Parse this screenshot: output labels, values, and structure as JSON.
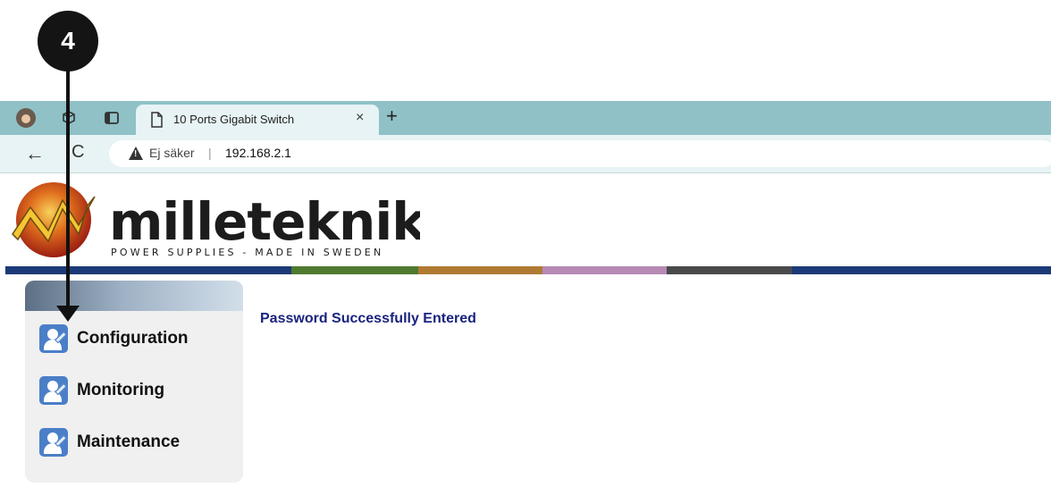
{
  "step": {
    "number": "4"
  },
  "browser": {
    "tab_title": "10 Ports Gigabit Switch",
    "tab_close": "×",
    "new_tab": "+",
    "security_label": "Ej säker",
    "url": "192.168.2.1",
    "back": "←",
    "reload": "C"
  },
  "header": {
    "logo_text": "milleteknik",
    "logo_tagline": "POWER SUPPLIES - MADE IN SWEDEN",
    "band_colors": [
      "#1d3a78",
      "#4f7a2f",
      "#b07a33",
      "#b68ab5",
      "#4a4a4a",
      "#1d3a78"
    ]
  },
  "sidebar": {
    "items": [
      {
        "label": "Configuration",
        "icon": "user-wrench-icon"
      },
      {
        "label": "Monitoring",
        "icon": "user-wrench-icon"
      },
      {
        "label": "Maintenance",
        "icon": "user-wrench-icon"
      }
    ]
  },
  "main": {
    "status_message": "Password Successfully Entered"
  }
}
